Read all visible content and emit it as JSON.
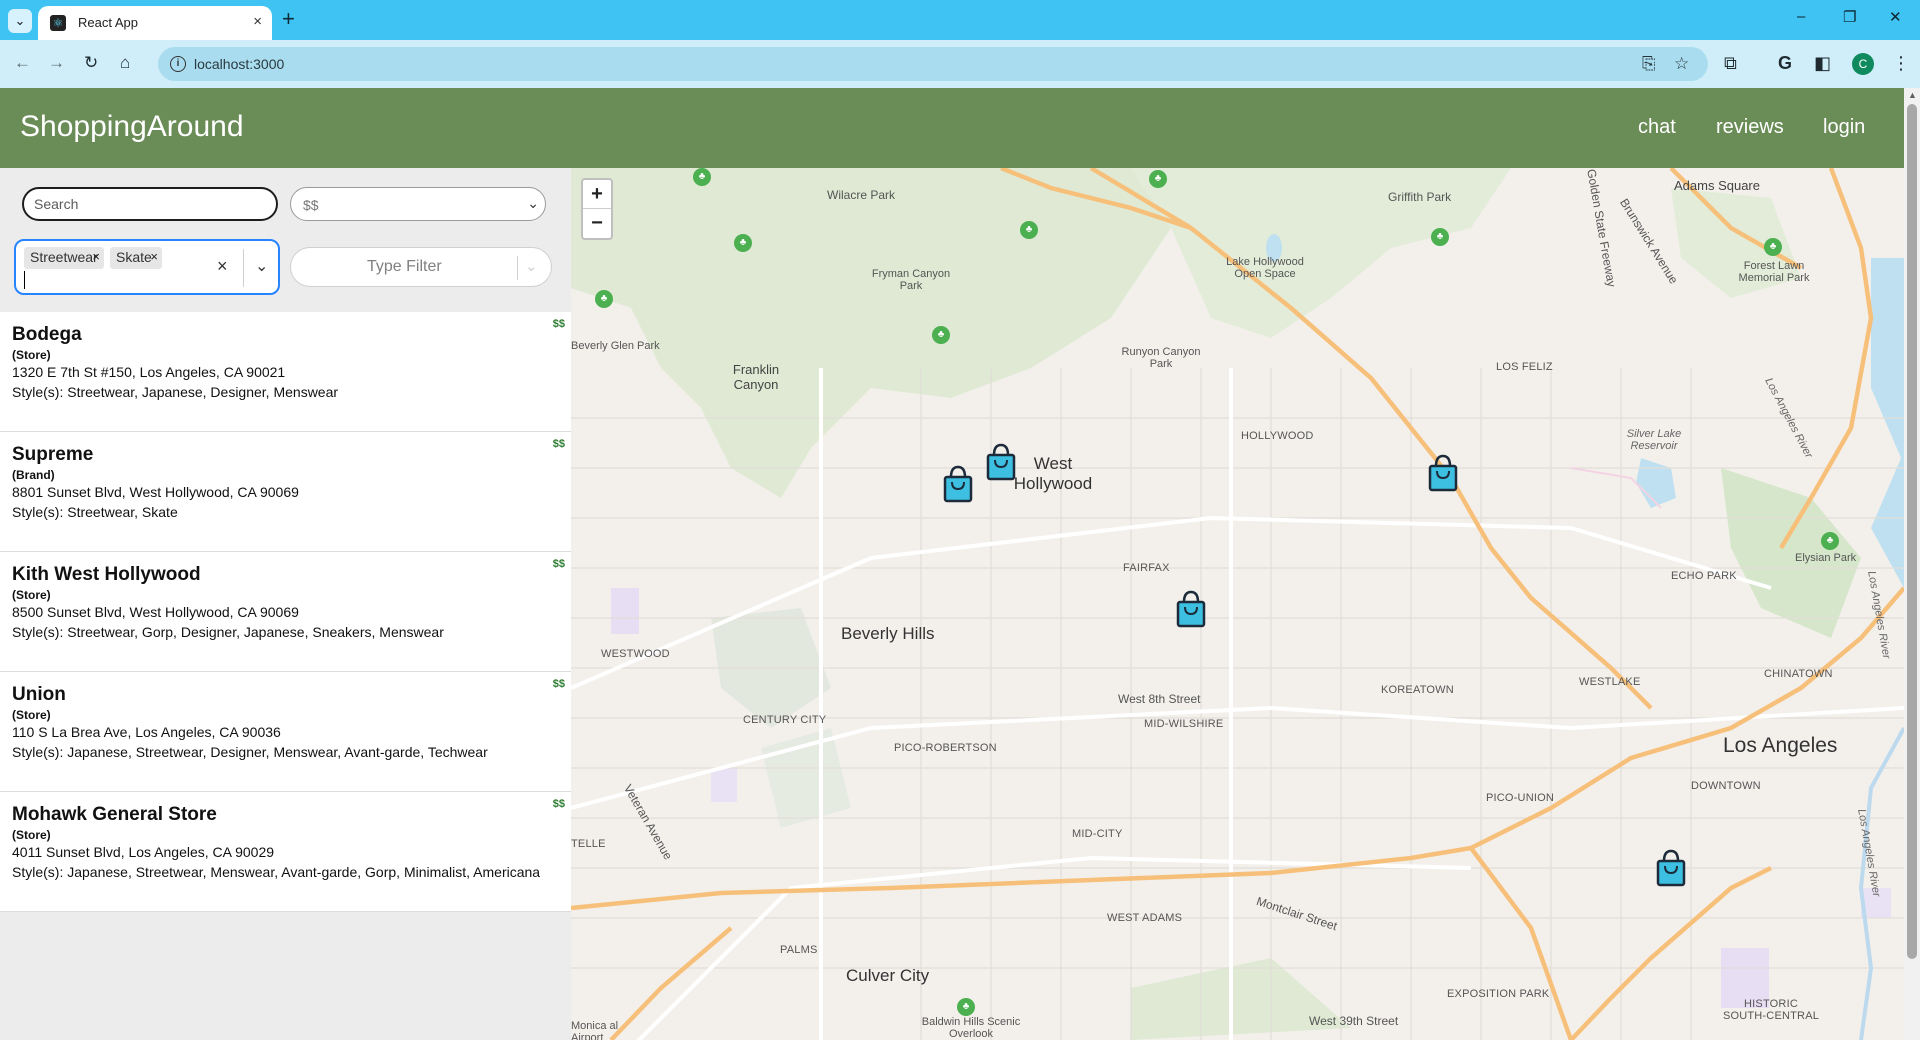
{
  "browser": {
    "tab_title": "React App",
    "url": "localhost:3000",
    "profile_initial": "C",
    "tab_close_glyph": "×",
    "new_tab_glyph": "+",
    "tab_menu_glyph": "⌄",
    "minimize_glyph": "–",
    "restore_glyph": "❐",
    "close_glyph": "✕"
  },
  "app": {
    "brand": "ShoppingAround",
    "nav": {
      "chat": "chat",
      "reviews": "reviews",
      "login": "login"
    },
    "header_color": "#6a8c56"
  },
  "filters": {
    "search_placeholder": "Search",
    "price_value": "$$",
    "style_chips": [
      "Streetwear",
      "Skate"
    ],
    "chip_remove_glyph": "×",
    "clear_glyph": "×",
    "type_placeholder": "Type Filter",
    "focus_color": "#2684ff"
  },
  "stores": [
    {
      "name": "Bodega",
      "type": "(Store)",
      "address": "1320 E 7th St #150, Los Angeles, CA 90021",
      "styles": "Style(s): Streetwear, Japanese, Designer, Menswear",
      "price": "$$"
    },
    {
      "name": "Supreme",
      "type": "(Brand)",
      "address": "8801 Sunset Blvd, West Hollywood, CA 90069",
      "styles": "Style(s): Streetwear, Skate",
      "price": "$$"
    },
    {
      "name": "Kith West Hollywood",
      "type": "(Store)",
      "address": "8500 Sunset Blvd, West Hollywood, CA 90069",
      "styles": "Style(s): Streetwear, Gorp, Designer, Japanese, Sneakers, Menswear",
      "price": "$$"
    },
    {
      "name": "Union",
      "type": "(Store)",
      "address": "110 S La Brea Ave, Los Angeles, CA 90036",
      "styles": "Style(s): Japanese, Streetwear, Designer, Menswear, Avant-garde, Techwear",
      "price": "$$"
    },
    {
      "name": "Mohawk General Store",
      "type": "(Store)",
      "address": "4011 Sunset Blvd, Los Angeles, CA 90029",
      "styles": "Style(s): Japanese, Streetwear, Menswear, Avant-garde, Gorp, Minimalist, Americana",
      "price": "$$"
    }
  ],
  "map": {
    "zoom_in": "+",
    "zoom_out": "−",
    "marker_color": "#3cbfe0",
    "labels": {
      "wilacre": "Wilacre Park",
      "griffith": "Griffith Park",
      "adams_square": "Adams Square",
      "forest_lawn": "Forest Lawn Memorial Park",
      "lake_hollywood": "Lake Hollywood Open Space",
      "fryman": "Fryman Canyon Park",
      "golden_state": "Golden State Freeway",
      "brunswick": "Brunswick Avenue",
      "beverly_glen": "Beverly Glen Park",
      "franklin": "Franklin Canyon",
      "runyon": "Runyon Canyon Park",
      "los_feliz": "LOS FELIZ",
      "la_river_1": "Los Angeles River",
      "la_river_2": "Los Angeles River",
      "la_river_3": "Los Angeles River",
      "silver_lake": "Silver Lake Reservoir",
      "hollywood": "HOLLYWOOD",
      "west_hollywood": "West Hollywood",
      "elysian": "Elysian Park",
      "fairfax": "FAIRFAX",
      "echo_park": "ECHO PARK",
      "beverly_hills": "Beverly Hills",
      "westwood": "WESTWOOD",
      "koreatown": "KOREATOWN",
      "westlake": "WESTLAKE",
      "chinatown": "CHINATOWN",
      "west_8th": "West 8th Street",
      "century_city": "CENTURY CITY",
      "mid_wilshire": "MID-WILSHIRE",
      "los_angeles": "Los Angeles",
      "pico_robertson": "PICO-ROBERTSON",
      "downtown": "DOWNTOWN",
      "pico_union": "PICO-UNION",
      "veteran": "Veteran Avenue",
      "telle": "TELLE",
      "mid_city": "MID-CITY",
      "west_adams": "WEST ADAMS",
      "montclair": "Montclair Street",
      "palms": "PALMS",
      "culver_city": "Culver City",
      "exposition": "EXPOSITION PARK",
      "historic_south": "HISTORIC SOUTH-CENTRAL",
      "baldwin": "Baldwin Hills Scenic Overlook",
      "west_39th": "West 39th Street",
      "monica": "Monica al Airport"
    }
  },
  "icons": {
    "back": "back-arrow-icon",
    "forward": "forward-arrow-icon",
    "reload": "reload-icon",
    "home": "home-icon",
    "info": "site-info-icon",
    "install": "install-app-icon",
    "bookmark": "star-icon",
    "extensions": "puzzle-icon",
    "grammarly": "g-icon",
    "sidepanel": "side-panel-icon",
    "menu": "kebab-menu-icon",
    "park": "tree-icon",
    "store_marker": "shopping-bag-icon"
  }
}
